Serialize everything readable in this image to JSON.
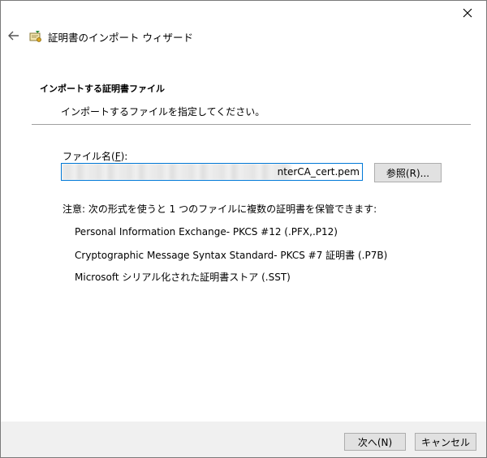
{
  "window": {
    "title": "証明書のインポート ウィザード"
  },
  "header": {
    "section_title": "インポートする証明書ファイル",
    "section_desc": "インポートするファイルを指定してください。"
  },
  "form": {
    "file_label_prefix": "ファイル名(",
    "file_label_key": "F",
    "file_label_suffix": "):",
    "file_value": "nterCA_cert.pem",
    "browse_label": "参照(R)..."
  },
  "note": "注意: 次の形式を使うと 1 つのファイルに複数の証明書を保管できます:",
  "formats": [
    "Personal Information Exchange- PKCS #12 (.PFX,.P12)",
    "Cryptographic Message Syntax Standard- PKCS #7 証明書 (.P7B)",
    "Microsoft シリアル化された証明書ストア (.SST)"
  ],
  "footer": {
    "next_label": "次へ(N)",
    "cancel_label": "キャンセル"
  },
  "icons": {
    "close": "close-icon",
    "back": "back-arrow-icon",
    "app": "certificate-icon"
  }
}
